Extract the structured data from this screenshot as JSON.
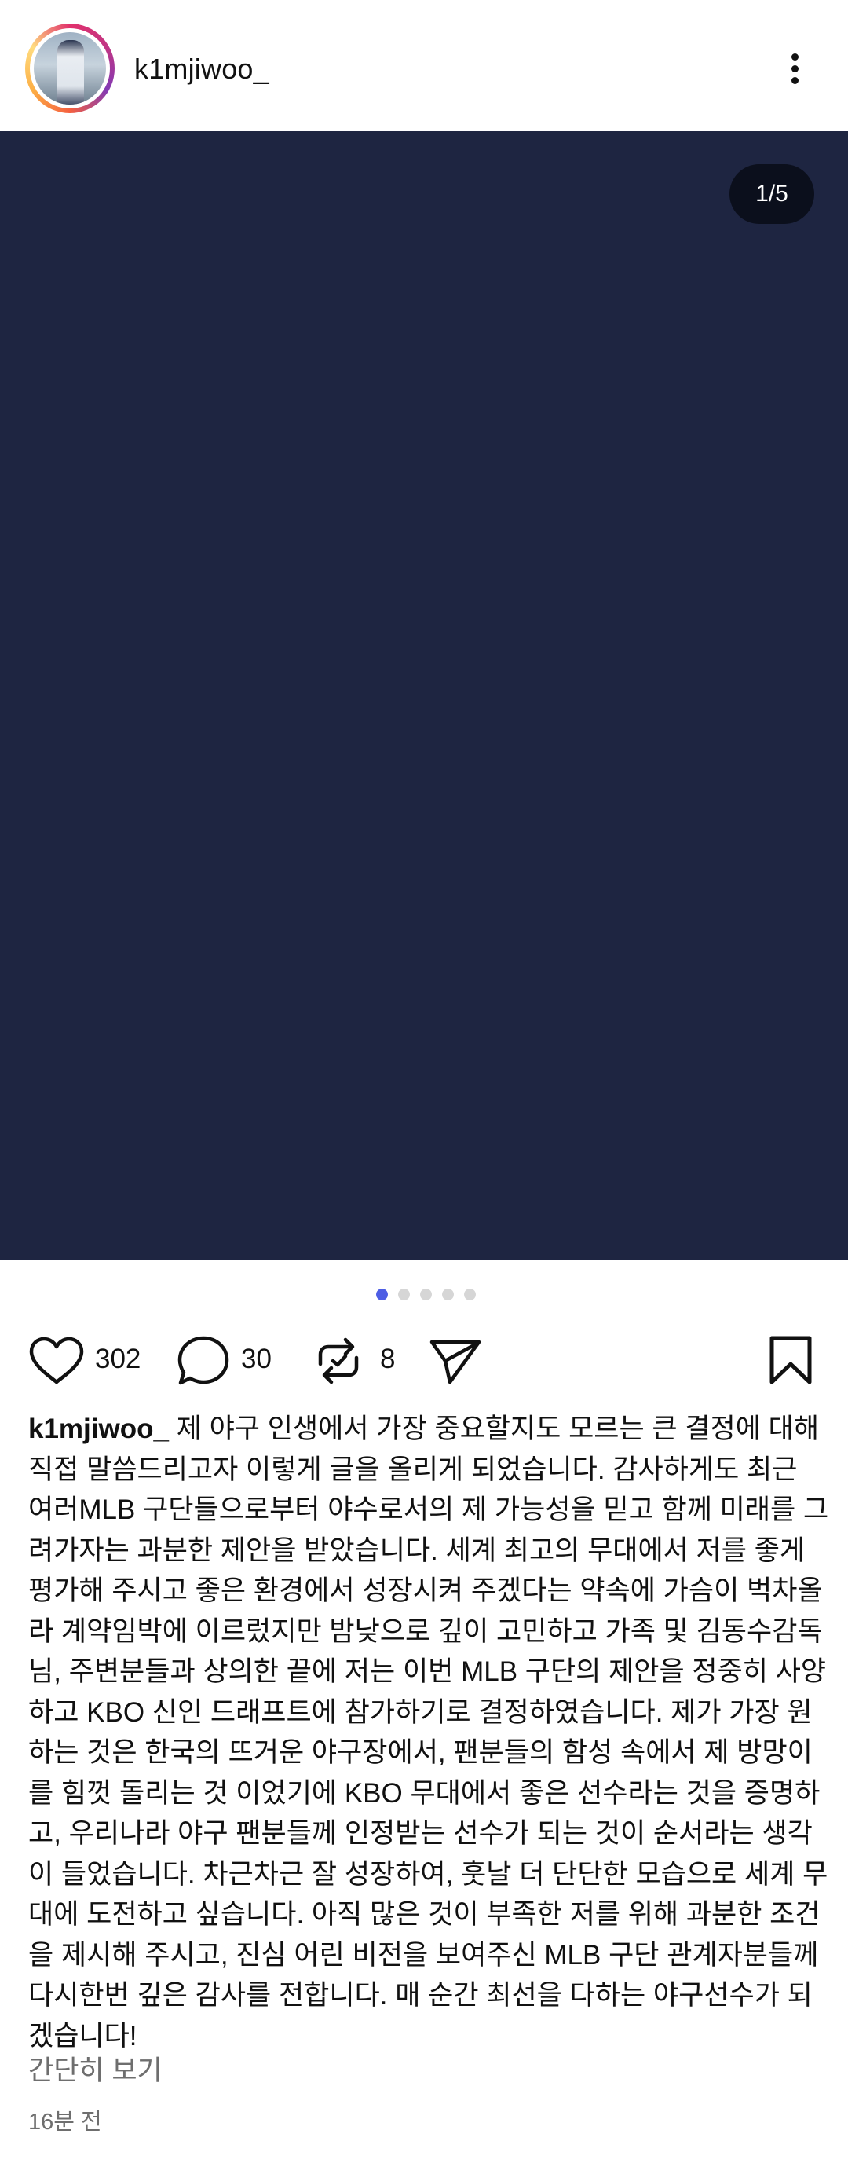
{
  "header": {
    "username": "k1mjiwoo_",
    "avatar_icon": "profile-photo",
    "more_icon": "more-vertical-icon"
  },
  "media": {
    "background_color": "#1e2541",
    "counter": "1/5",
    "slide_count": 5,
    "active_slide": 1
  },
  "actions": {
    "like_count": "302",
    "comment_count": "30",
    "repost_count": "8",
    "icons": [
      "heart-icon",
      "comment-icon",
      "repost-icon",
      "send-icon",
      "bookmark-icon"
    ]
  },
  "caption": {
    "username": "k1mjiwoo_",
    "text": "제 야구 인생에서 가장 중요할지도 모르는 큰 결정에 대해 직접 말씀드리고자 이렇게 글을 올리게 되었습니다. 감사하게도 최근 여러MLB 구단들으로부터 야수로서의 제 가능성을 믿고 함께 미래를 그려가자는 과분한 제안을 받았습니다. 세계 최고의 무대에서 저를 좋게 평가해 주시고 좋은 환경에서 성장시켜 주겠다는 약속에 가슴이 벅차올라 계약임박에 이르렀지만 밤낮으로 깊이 고민하고 가족 및 김동수감독님, 주변분들과 상의한 끝에 저는 이번 MLB 구단의 제안을 정중히 사양하고 KBO 신인 드래프트에 참가하기로 결정하였습니다. 제가 가장 원하는 것은 한국의 뜨거운 야구장에서, 팬분들의 함성 속에서 제 방망이를 힘껏 돌리는 것 이었기에 KBO 무대에서 좋은 선수라는 것을 증명하고, 우리나라 야구 팬분들께 인정받는 선수가 되는 것이 순서라는 생각이 들었습니다. 차근차근 잘 성장하여, 훗날 더 단단한 모습으로 세계 무대에 도전하고 싶습니다. 아직 많은 것이 부족한 저를 위해 과분한 조건을 제시해 주시고, 진심 어린 비전을 보여주신 MLB 구단 관계자분들께 다시한번 깊은 감사를 전합니다. 매 순간 최선을 다하는 야구선수가 되겠습니다!",
    "collapse_label": "간단히 보기",
    "timestamp": "16분 전"
  },
  "colors": {
    "accent": "#4e5ee4",
    "muted_text": "#6e6e6e",
    "counter_bg": "#0b0f1c"
  }
}
